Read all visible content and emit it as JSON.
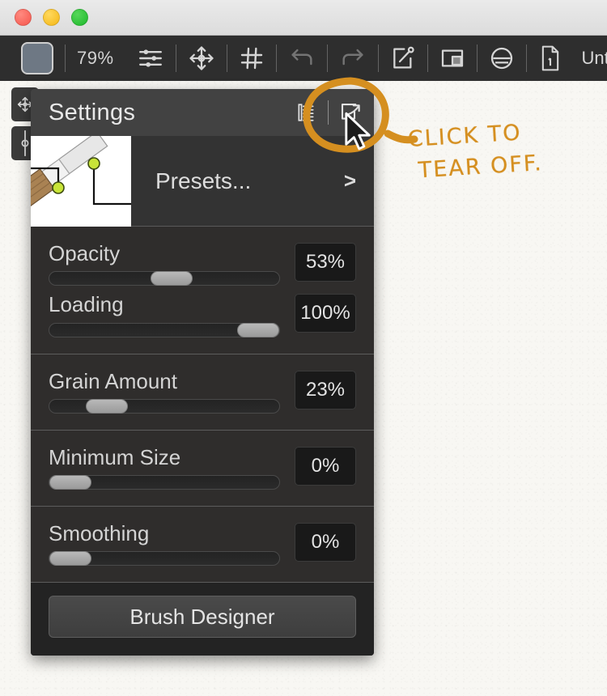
{
  "window": {
    "traffic_lights": [
      {
        "name": "close",
        "color": "#f6564c"
      },
      {
        "name": "minimize",
        "color": "#f5b715"
      },
      {
        "name": "maximize",
        "color": "#1db82b"
      }
    ]
  },
  "toolbar": {
    "color_swatch": {
      "label": "",
      "color": "#6e7884"
    },
    "zoom_level": "79%",
    "items": [
      {
        "icon": "color-swatch-icon",
        "label": ""
      },
      {
        "icon": "zoom-level-label",
        "label": "79%"
      },
      {
        "icon": "sliders-icon",
        "label": ""
      },
      {
        "icon": "move-transform-icon",
        "label": ""
      },
      {
        "icon": "grid-icon",
        "label": ""
      },
      {
        "icon": "undo-icon",
        "label": ""
      },
      {
        "icon": "redo-icon",
        "label": ""
      },
      {
        "icon": "share-export-icon",
        "label": ""
      },
      {
        "icon": "layers-icon",
        "label": ""
      },
      {
        "icon": "color-wheel-icon",
        "label": ""
      },
      {
        "icon": "document-icon",
        "label": ""
      }
    ],
    "document_title": "Unti"
  },
  "left_rail": {
    "items": [
      {
        "icon": "move-tool-icon",
        "label": ""
      },
      {
        "icon": "slider-tool-icon",
        "label": ""
      }
    ]
  },
  "panel": {
    "title": "Settings",
    "header_icons": [
      {
        "icon": "list-menu-icon",
        "label": ""
      },
      {
        "icon": "tear-off-icon",
        "label": ""
      }
    ],
    "preset": {
      "thumbnail": "brush-preview-thumbnail",
      "label": "Presets...",
      "chevron": ">"
    },
    "groups": [
      {
        "controls": [
          {
            "label": "Opacity",
            "value": "53%",
            "percent": 53
          },
          {
            "label": "Loading",
            "value": "100%",
            "percent": 100
          }
        ]
      },
      {
        "controls": [
          {
            "label": "Grain Amount",
            "value": "23%",
            "percent": 23
          }
        ]
      },
      {
        "controls": [
          {
            "label": "Minimum Size",
            "value": "0%",
            "percent": 0
          }
        ]
      },
      {
        "controls": [
          {
            "label": "Smoothing",
            "value": "0%",
            "percent": 0
          }
        ]
      }
    ],
    "footer_button": "Brush Designer"
  },
  "annotation": {
    "text": "CLICK TO\n TEAR OFF.",
    "color": "#d58f20",
    "target_icon": "tear-off-icon"
  },
  "colors": {
    "panel_header_bg": "#424242",
    "panel_section_bg": "#2f2d2c",
    "panel_footer_bg": "#232323",
    "value_box_bg": "#191919",
    "toolbar_bg": "#2e2e2e",
    "canvas_bg": "#f8f7f3",
    "annotation": "#d58f20"
  }
}
